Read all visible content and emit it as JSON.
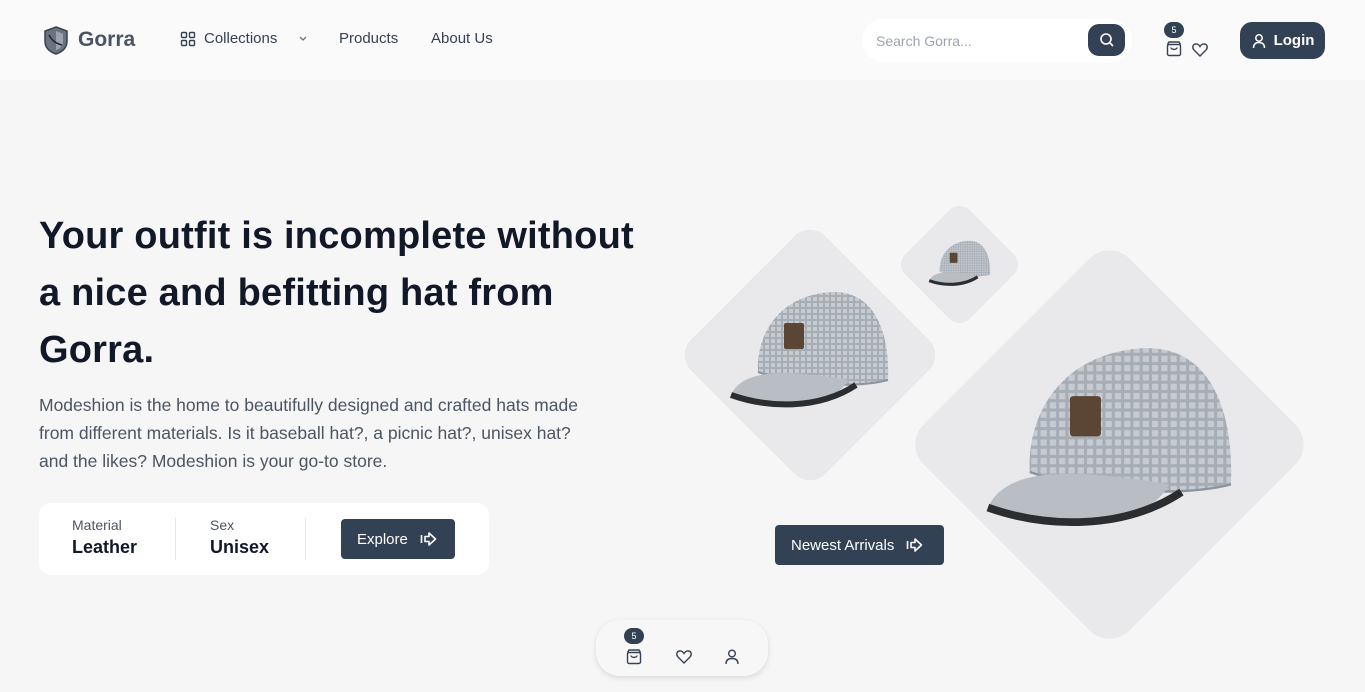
{
  "header": {
    "brand": "Gorra",
    "nav": {
      "collections": "Collections",
      "products": "Products",
      "about": "About Us"
    },
    "search": {
      "placeholder": "Search Gorra..."
    },
    "cart_count": "5",
    "login_label": "Login"
  },
  "hero": {
    "title": "Your outfit is incomplete without a nice and befitting hat from Gorra.",
    "description": "Modeshion is the home to beautifully designed and crafted hats made from different materials. Is it baseball hat?, a picnic hat?, unisex hat? and the likes? Modeshion is your go-to store.",
    "material_label": "Material",
    "material_value": "Leather",
    "sex_label": "Sex",
    "sex_value": "Unisex",
    "explore_label": "Explore",
    "newest_label": "Newest Arrivals"
  },
  "bottom_bar": {
    "cart_count": "5"
  },
  "colors": {
    "accent": "#334155",
    "background": "#f6f6f6",
    "diamond": "#e9e9eb"
  },
  "icons": [
    "logo-icon",
    "grid-icon",
    "chevron-down-icon",
    "search-icon",
    "shopping-bag-icon",
    "heart-icon",
    "user-icon",
    "arrow-right-icon"
  ]
}
